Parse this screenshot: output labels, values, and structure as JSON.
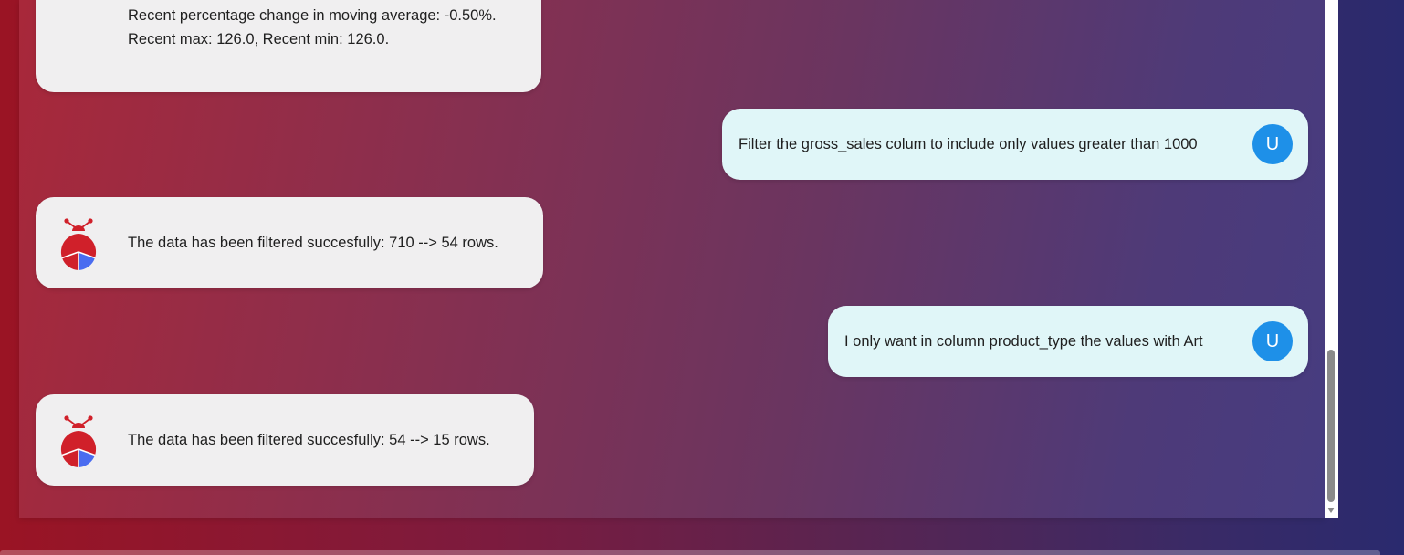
{
  "messages": [
    {
      "role": "bot",
      "lines": [
        "Recent percentage change in moving average: -0.50%.",
        "Recent max: 126.0, Recent min: 126.0."
      ]
    },
    {
      "role": "user",
      "text": "Filter the gross_sales colum to include only values greater than 1000",
      "avatar_letter": "U"
    },
    {
      "role": "bot",
      "text": "The data has been filtered succesfully: 710 --> 54 rows."
    },
    {
      "role": "user",
      "text": "I only want in column product_type the values with Art",
      "avatar_letter": "U"
    },
    {
      "role": "bot",
      "text": "The data has been filtered succesfully: 54 --> 15 rows."
    }
  ],
  "icons": {
    "bot_avatar": "ladybug-robot-icon",
    "scroll_down": "scroll-down-arrow-icon"
  },
  "colors": {
    "user_bubble": "#e0f6f8",
    "bot_bubble": "#f0eff0",
    "user_avatar": "#1e90e8",
    "bot_red": "#d0202a",
    "bot_blue": "#4a6cf0"
  },
  "scroll": {
    "position_fraction": 0.95
  }
}
